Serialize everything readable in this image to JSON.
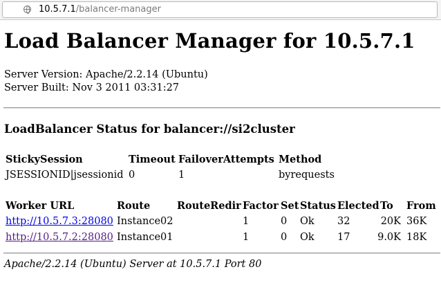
{
  "address_bar": {
    "host": "10.5.7.1",
    "path": "/balancer-manager"
  },
  "page": {
    "title": "Load Balancer Manager for 10.5.7.1",
    "server_version": "Server Version: Apache/2.2.14 (Ubuntu)",
    "server_built": "Server Built: Nov 3 2011 03:31:27",
    "balancer_heading": "LoadBalancer Status for balancer://si2cluster"
  },
  "balancer_table": {
    "headers": [
      "StickySession",
      "Timeout",
      "FailoverAttempts",
      "Method"
    ],
    "row": [
      "JSESSIONID|jsessionid",
      "0",
      "1",
      "byrequests"
    ]
  },
  "workers_table": {
    "headers": [
      "Worker URL",
      "Route",
      "RouteRedir",
      "Factor",
      "Set",
      "Status",
      "Elected",
      "To",
      "From"
    ],
    "rows": [
      {
        "url": "http://10.5.7.3:28080",
        "route": "Instance02",
        "route_redir": "",
        "factor": "1",
        "set": "0",
        "status": "Ok",
        "elected": "32",
        "to": "20K",
        "from": "36K"
      },
      {
        "url": "http://10.5.7.2:28080",
        "route": "Instance01",
        "route_redir": "",
        "factor": "1",
        "set": "0",
        "status": "Ok",
        "elected": "17",
        "to": "9.0K",
        "from": "18K"
      }
    ]
  },
  "footer": "Apache/2.2.14 (Ubuntu) Server at 10.5.7.1 Port 80",
  "colors": {
    "link": "#0000ee",
    "visited_link": "#551a8b"
  }
}
